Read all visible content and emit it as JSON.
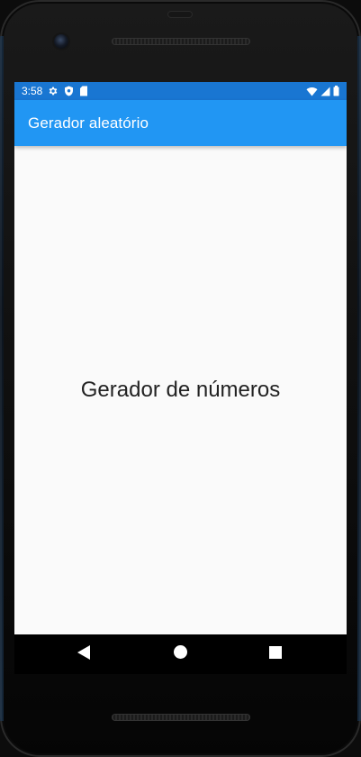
{
  "status_bar": {
    "time": "3:58",
    "left_icons": [
      "gear-icon",
      "shield-icon",
      "sd-card-icon"
    ],
    "right_icons": [
      "wifi-icon",
      "cell-signal-icon",
      "battery-icon"
    ]
  },
  "app_bar": {
    "title": "Gerador aleatório",
    "color": "#2196f3",
    "status_color": "#1976d2"
  },
  "main": {
    "text": "Gerador de números"
  },
  "navigation": {
    "buttons": [
      "back-icon",
      "home-icon",
      "recent-apps-icon"
    ]
  }
}
